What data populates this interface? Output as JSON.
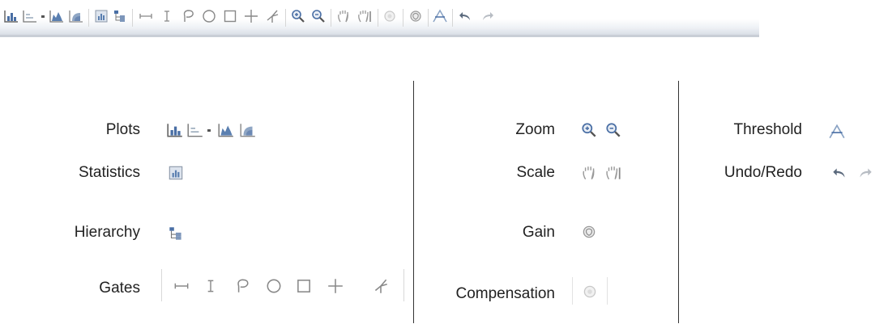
{
  "legend": {
    "plots_label": "Plots",
    "statistics_label": "Statistics",
    "hierarchy_label": "Hierarchy",
    "gates_label": "Gates",
    "zoom_label": "Zoom",
    "scale_label": "Scale",
    "gain_label": "Gain",
    "compensation_label": "Compensation",
    "threshold_label": "Threshold",
    "undo_redo_label": "Undo/Redo"
  },
  "toolbar_icons": [
    "histogram-icon",
    "dot-plot-icon",
    "dropdown-arrow-icon",
    "density-plot-icon",
    "contour-plot-icon",
    "statistics-icon",
    "hierarchy-icon",
    "range-gate-icon",
    "interval-gate-icon",
    "lasso-gate-icon",
    "ellipse-gate-icon",
    "rectangle-gate-icon",
    "quadrant-gate-icon",
    "spider-gate-icon",
    "zoom-in-icon",
    "zoom-out-icon",
    "scale-hand-icon",
    "scale-hand-bar-icon",
    "compensation-icon",
    "gain-icon",
    "threshold-icon",
    "undo-icon",
    "redo-icon"
  ],
  "colors": {
    "icon_blue": "#5a7fb0",
    "icon_gray": "#8a8f96",
    "icon_light": "#b5b9bf",
    "toolbar_border": "#c9ced6"
  }
}
